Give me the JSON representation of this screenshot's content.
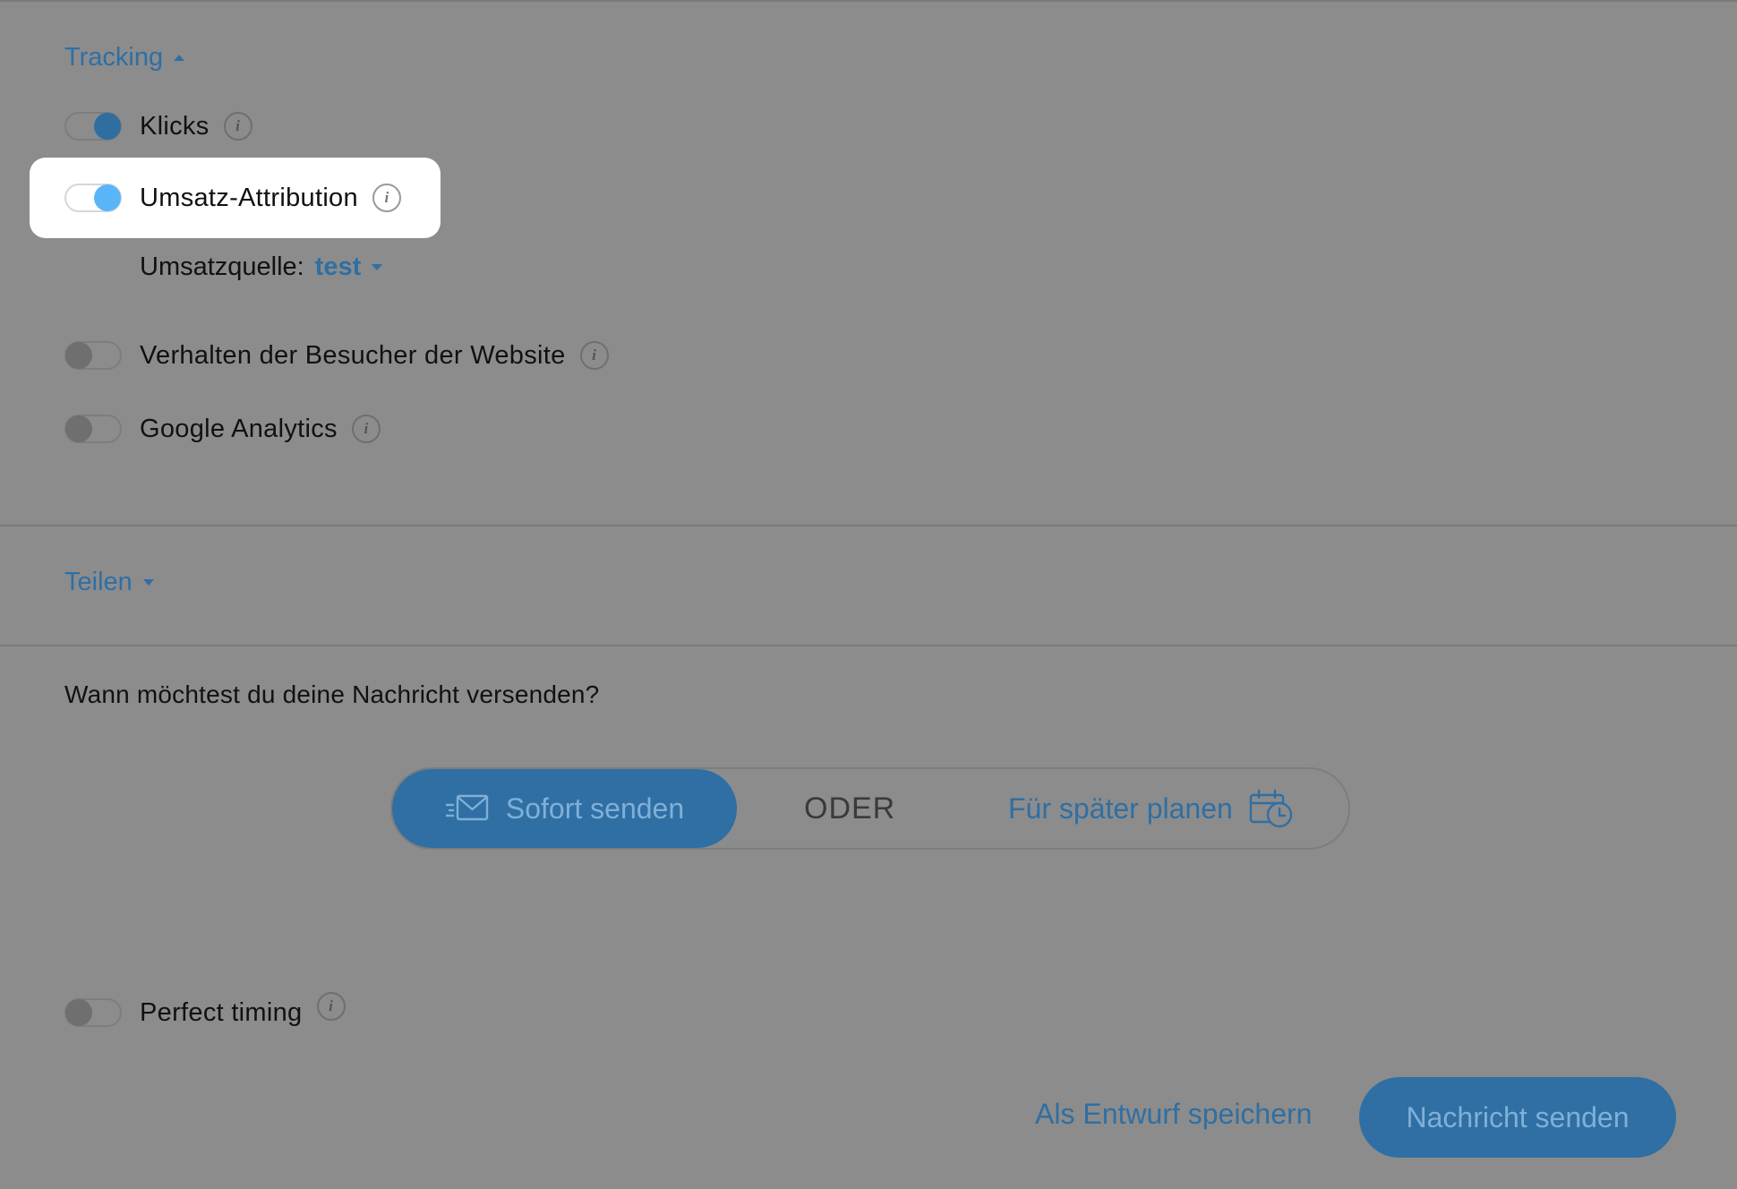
{
  "tracking": {
    "header": "Tracking",
    "items": {
      "clicks": {
        "label": "Klicks",
        "enabled": true
      },
      "revenue_attribution": {
        "label": "Umsatz-Attribution",
        "enabled": true
      },
      "visitor_behavior": {
        "label": "Verhalten der Besucher der Website",
        "enabled": false
      },
      "google_analytics": {
        "label": "Google Analytics",
        "enabled": false
      }
    },
    "revenue_source": {
      "label": "Umsatzquelle:",
      "value": "test"
    }
  },
  "share": {
    "header": "Teilen"
  },
  "schedule": {
    "question": "Wann möchtest du deine Nachricht versenden?",
    "send_now_label": "Sofort senden",
    "or_label": "ODER",
    "plan_later_label": "Für später planen"
  },
  "perfect_timing": {
    "label": "Perfect timing",
    "enabled": false
  },
  "footer": {
    "save_draft_label": "Als Entwurf speichern",
    "send_message_label": "Nachricht senden"
  },
  "icons": {
    "info": "info-icon",
    "send": "envelope-send-icon",
    "calendar": "calendar-clock-icon",
    "caret_up": "caret-up-icon",
    "caret_down": "caret-down-icon"
  },
  "colors": {
    "accent": "#2f6fa3",
    "toggle_on": "#59b5f8",
    "overlay_bg": "#8c8c8c"
  }
}
